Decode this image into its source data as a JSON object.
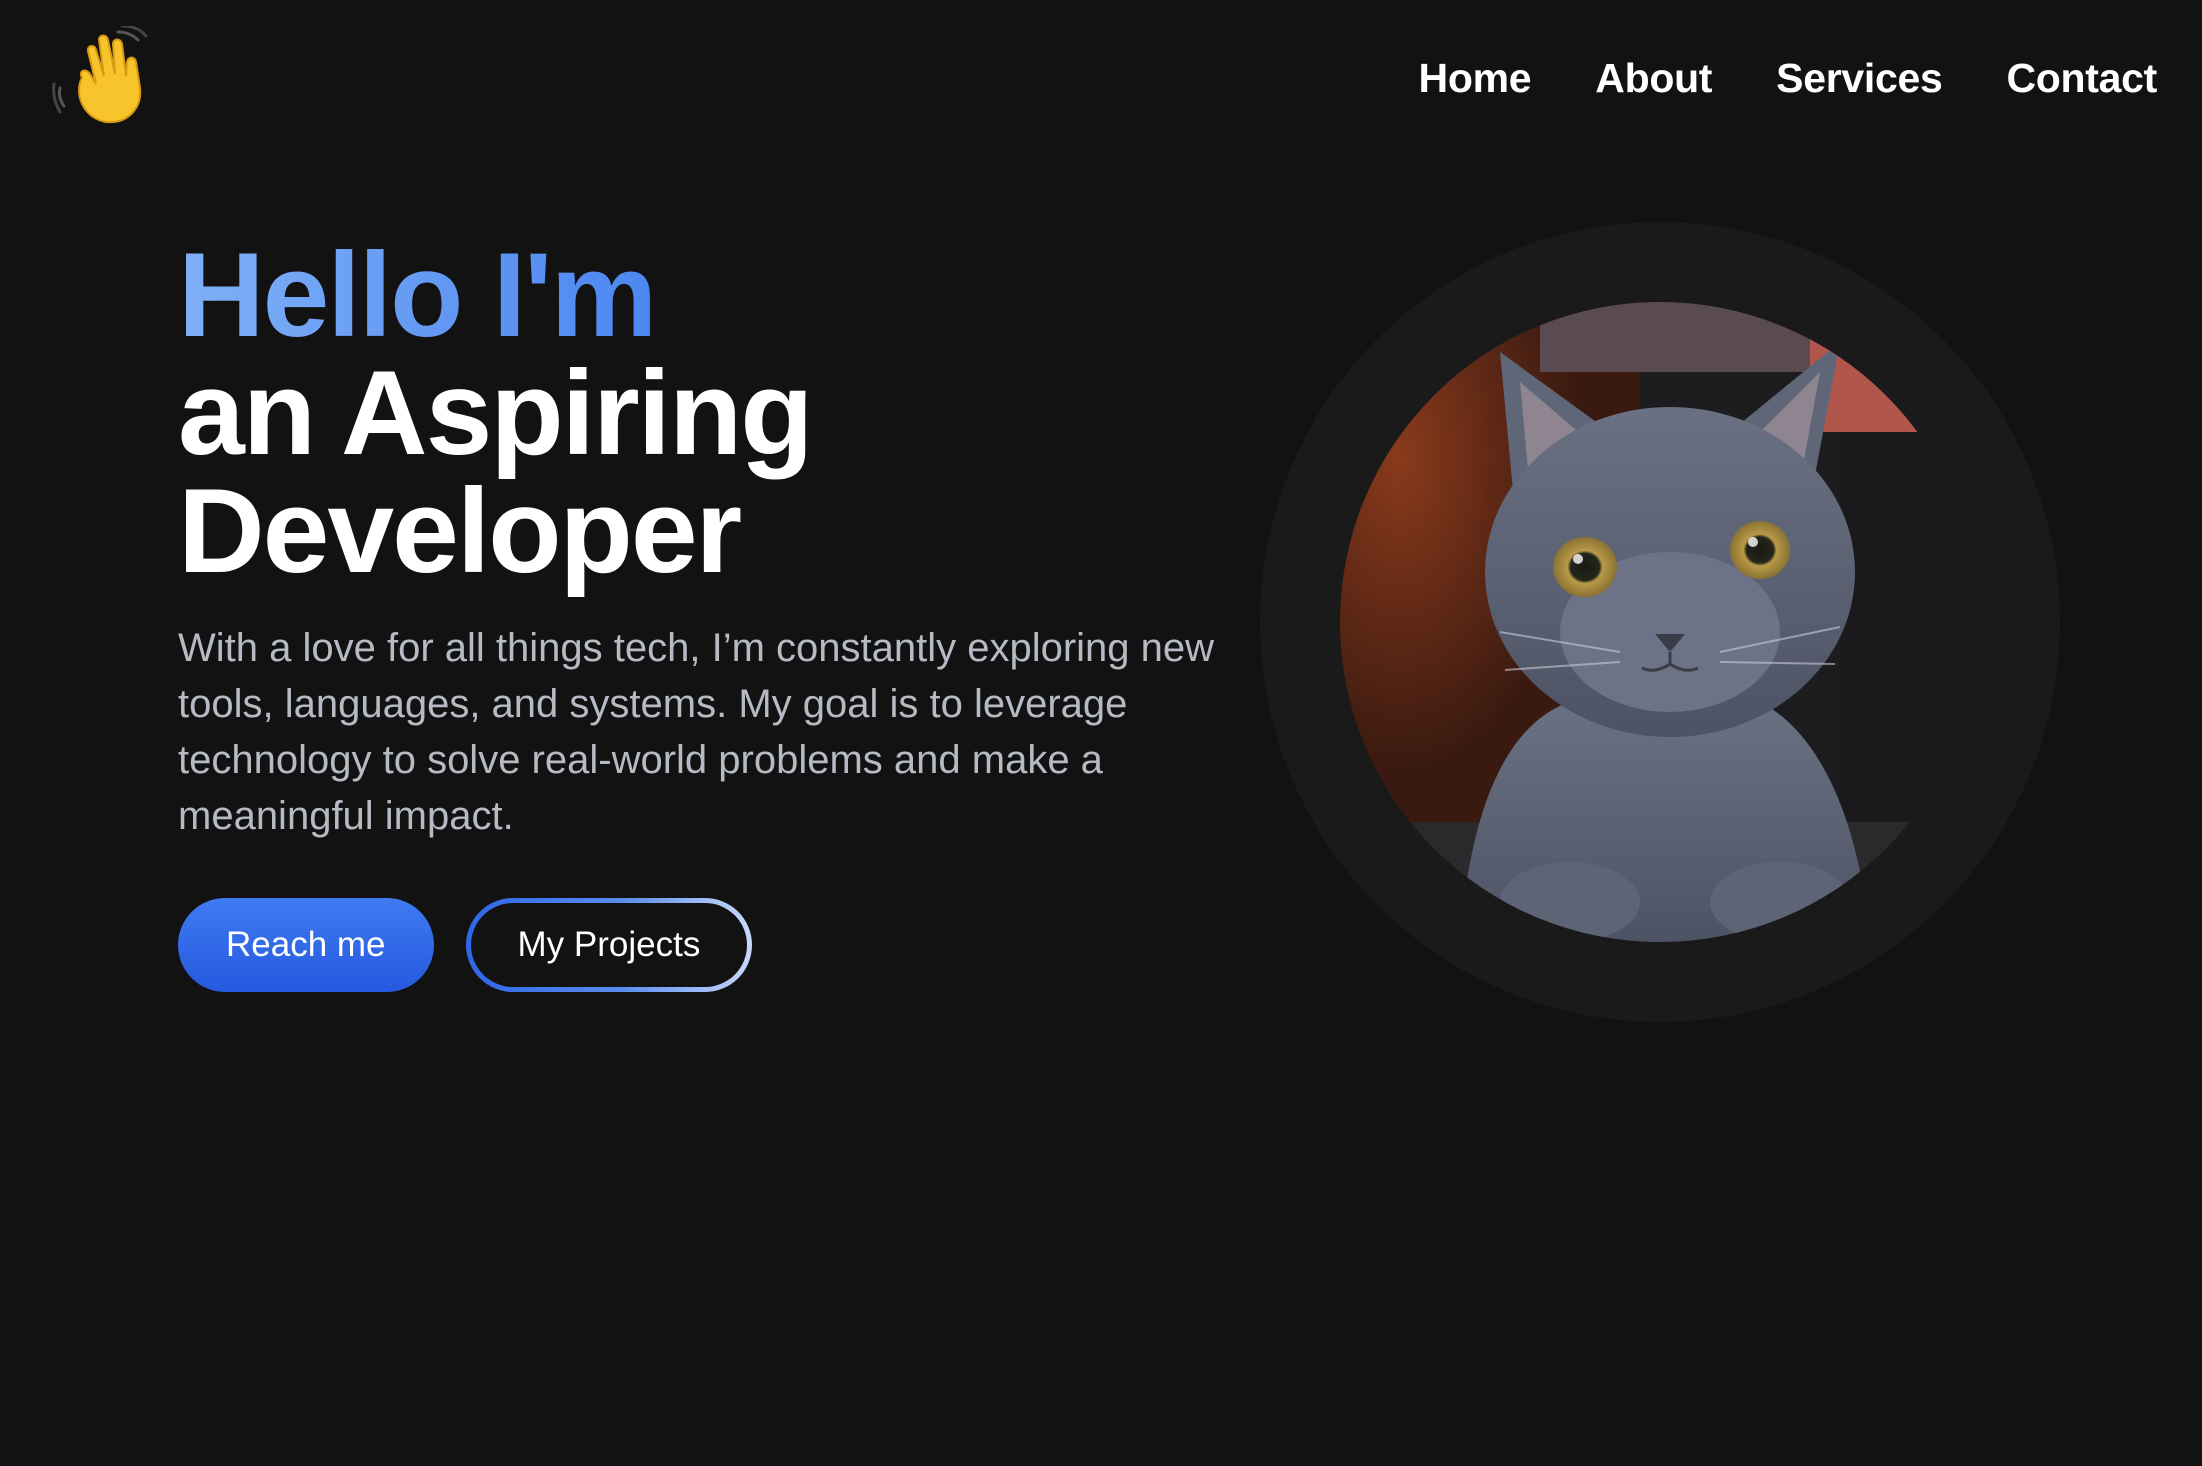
{
  "header": {
    "logo_icon": "waving-hand-icon",
    "nav": [
      {
        "label": "Home"
      },
      {
        "label": "About"
      },
      {
        "label": "Services"
      },
      {
        "label": "Contact"
      }
    ]
  },
  "hero": {
    "greeting": "Hello I'm",
    "title_line1": "an Aspiring",
    "title_line2": "Developer",
    "description": "With a love for all things tech, I’m constantly exploring new tools, languages, and systems. My goal is to leverage technology to solve real-world problems and make a meaningful impact.",
    "primary_button": "Reach me",
    "secondary_button": "My Projects"
  },
  "portrait": {
    "subject": "gray-cat-photo"
  },
  "colors": {
    "background": "#121212",
    "accent": "#2f66e8",
    "accent_light": "#7fb0f7",
    "text": "#ffffff",
    "muted_text": "#b5bac3",
    "ring": "#1a1a1a"
  }
}
